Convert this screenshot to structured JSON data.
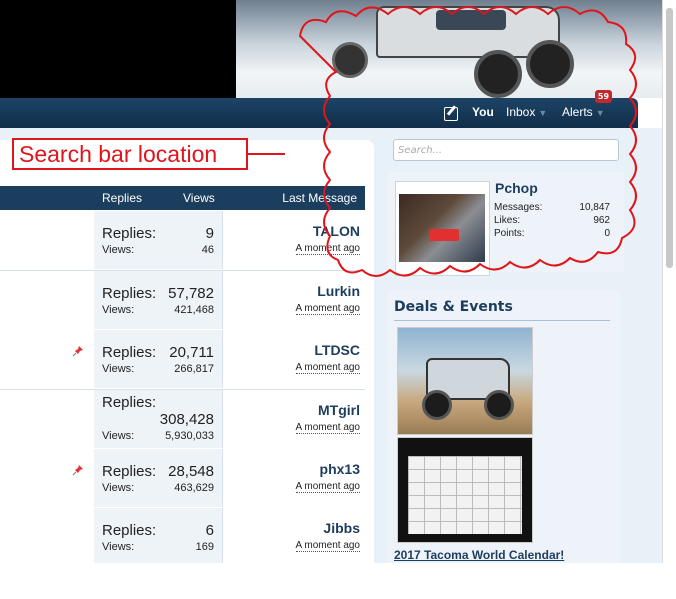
{
  "nav": {
    "you": "You",
    "inbox": "Inbox",
    "alerts": "Alerts",
    "alerts_count": "59",
    "arrow": "▼"
  },
  "table": {
    "col_replies": "Replies",
    "col_views": "Views",
    "col_last": "Last Message",
    "rows": [
      {
        "replies_label": "Replies:",
        "replies": "9",
        "views_label": "Views:",
        "views": "46",
        "last_user": "TALON",
        "last_time": "A moment ago",
        "pinned": false
      },
      {
        "replies_label": "Replies:",
        "replies": "57,782",
        "views_label": "Views:",
        "views": "421,468",
        "last_user": "Lurkin",
        "last_time": "A moment ago",
        "pinned": false
      },
      {
        "replies_label": "Replies:",
        "replies": "20,711",
        "views_label": "Views:",
        "views": "266,817",
        "last_user": "LTDSC",
        "last_time": "A moment ago",
        "pinned": true
      },
      {
        "replies_label": "Replies:",
        "replies": "308,428",
        "views_label": "Views:",
        "views": "5,930,033",
        "last_user": "MTgirl",
        "last_time": "A moment ago",
        "pinned": false
      },
      {
        "replies_label": "Replies:",
        "replies": "28,548",
        "views_label": "Views:",
        "views": "463,629",
        "last_user": "phx13",
        "last_time": "A moment ago",
        "pinned": true
      },
      {
        "replies_label": "Replies:",
        "replies": "6",
        "views_label": "Views:",
        "views": "169",
        "last_user": "Jibbs",
        "last_time": "A moment ago",
        "pinned": false
      }
    ]
  },
  "sidebar": {
    "search_placeholder": "Search...",
    "profile": {
      "username": "Pchop",
      "messages_label": "Messages:",
      "messages": "10,847",
      "likes_label": "Likes:",
      "likes": "962",
      "points_label": "Points:",
      "points": "0"
    },
    "deals_title": "Deals & Events",
    "deal_link": "2017 Tacoma World Calendar!"
  },
  "annotation": {
    "callout_text": "Search bar location",
    "color": "#e0151b"
  },
  "colors": {
    "navbar": "#102e4a",
    "table_header": "#1b3e5f",
    "username": "#1d3d5c",
    "badge": "#c2282c"
  },
  "icons": [
    "compose-icon",
    "pin-icon",
    "dropdown-arrow-icon"
  ]
}
